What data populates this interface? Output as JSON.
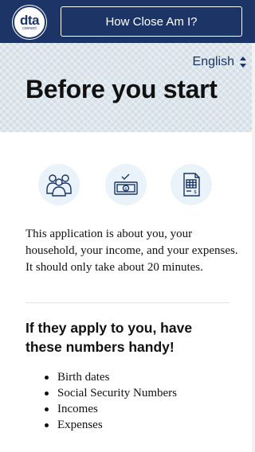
{
  "header": {
    "logo_mark": "dta",
    "logo_sub": "connect",
    "how_close_button": "How Close Am I?"
  },
  "language_selector": {
    "selected": "English"
  },
  "page": {
    "title": "Before you start"
  },
  "icons": [
    {
      "name": "household-people-icon"
    },
    {
      "name": "income-money-icon"
    },
    {
      "name": "expenses-bill-icon"
    }
  ],
  "intro": {
    "text": "This application is about you, your household, your income, and your expenses. It should only take about 20 minutes."
  },
  "numbers_section": {
    "heading": "If they apply to you, have these numbers handy!",
    "items": [
      "Birth dates",
      "Social Security Numbers",
      "Incomes",
      "Expenses"
    ]
  },
  "colors": {
    "header_bg": "#1d3566",
    "hero_bg": "#dde6ec",
    "icon_bg": "#eaf3f9",
    "icon_stroke": "#1d3566"
  }
}
